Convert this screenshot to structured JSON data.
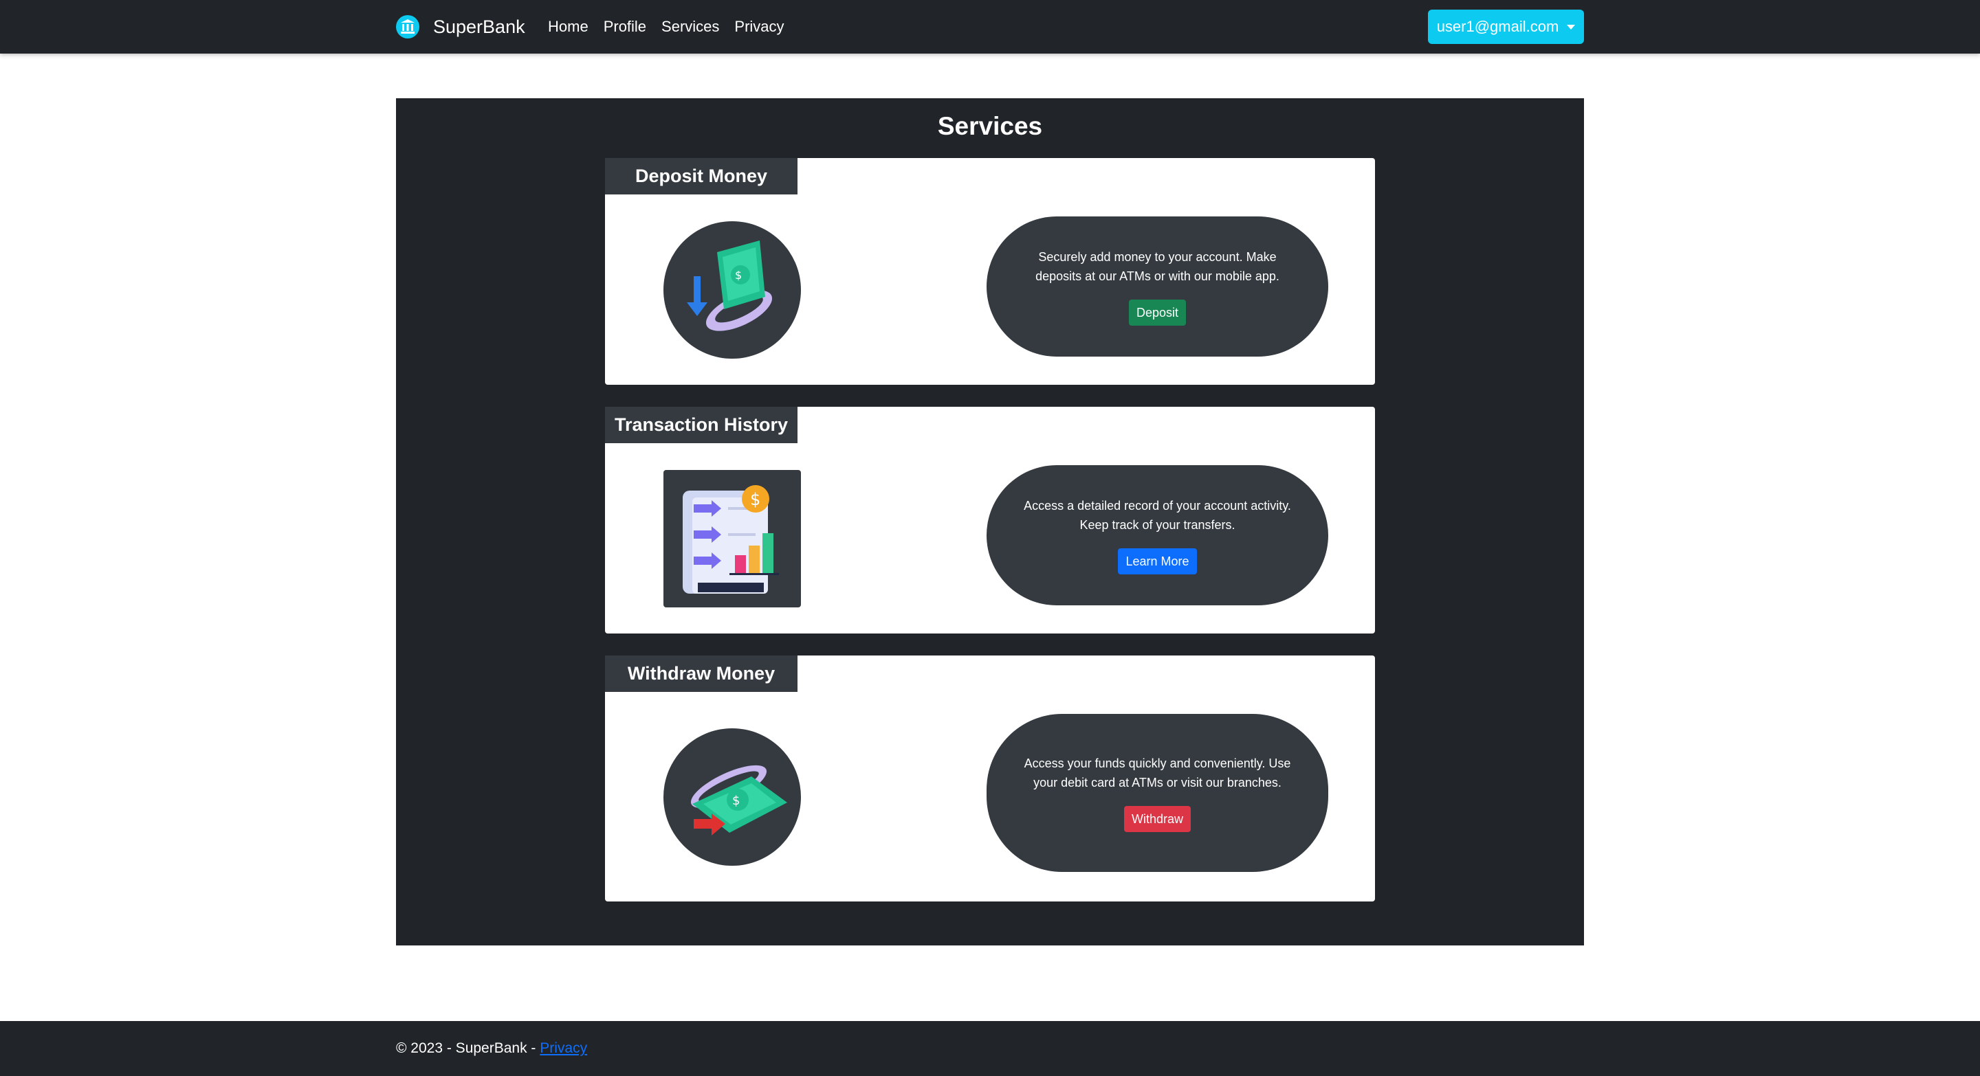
{
  "navbar": {
    "brand": "SuperBank",
    "brand_icon": "bank-icon",
    "links": [
      "Home",
      "Profile",
      "Services",
      "Privacy"
    ],
    "user_email": "user1@gmail.com",
    "background": "#212529",
    "user_button_color": "#0dcaf0"
  },
  "main": {
    "title": "Services",
    "cards": [
      {
        "title": "Deposit Money",
        "icon": "deposit-money-icon",
        "description": "Securely add money to your account. Make deposits at our ATMs or with our mobile app.",
        "button": "Deposit",
        "button_color": "#198754"
      },
      {
        "title": "Transaction History",
        "icon": "transaction-history-icon",
        "description": "Access a detailed record of your account activity. Keep track of your transfers.",
        "button": "Learn More",
        "button_color": "#0d6efd"
      },
      {
        "title": "Withdraw Money",
        "icon": "withdraw-money-icon",
        "description": "Access your funds quickly and conveniently. Use your debit card at ATMs or visit our branches.",
        "button": "Withdraw",
        "button_color": "#dc3545"
      }
    ]
  },
  "footer": {
    "text": "© 2023 - SuperBank - ",
    "link": "Privacy"
  }
}
